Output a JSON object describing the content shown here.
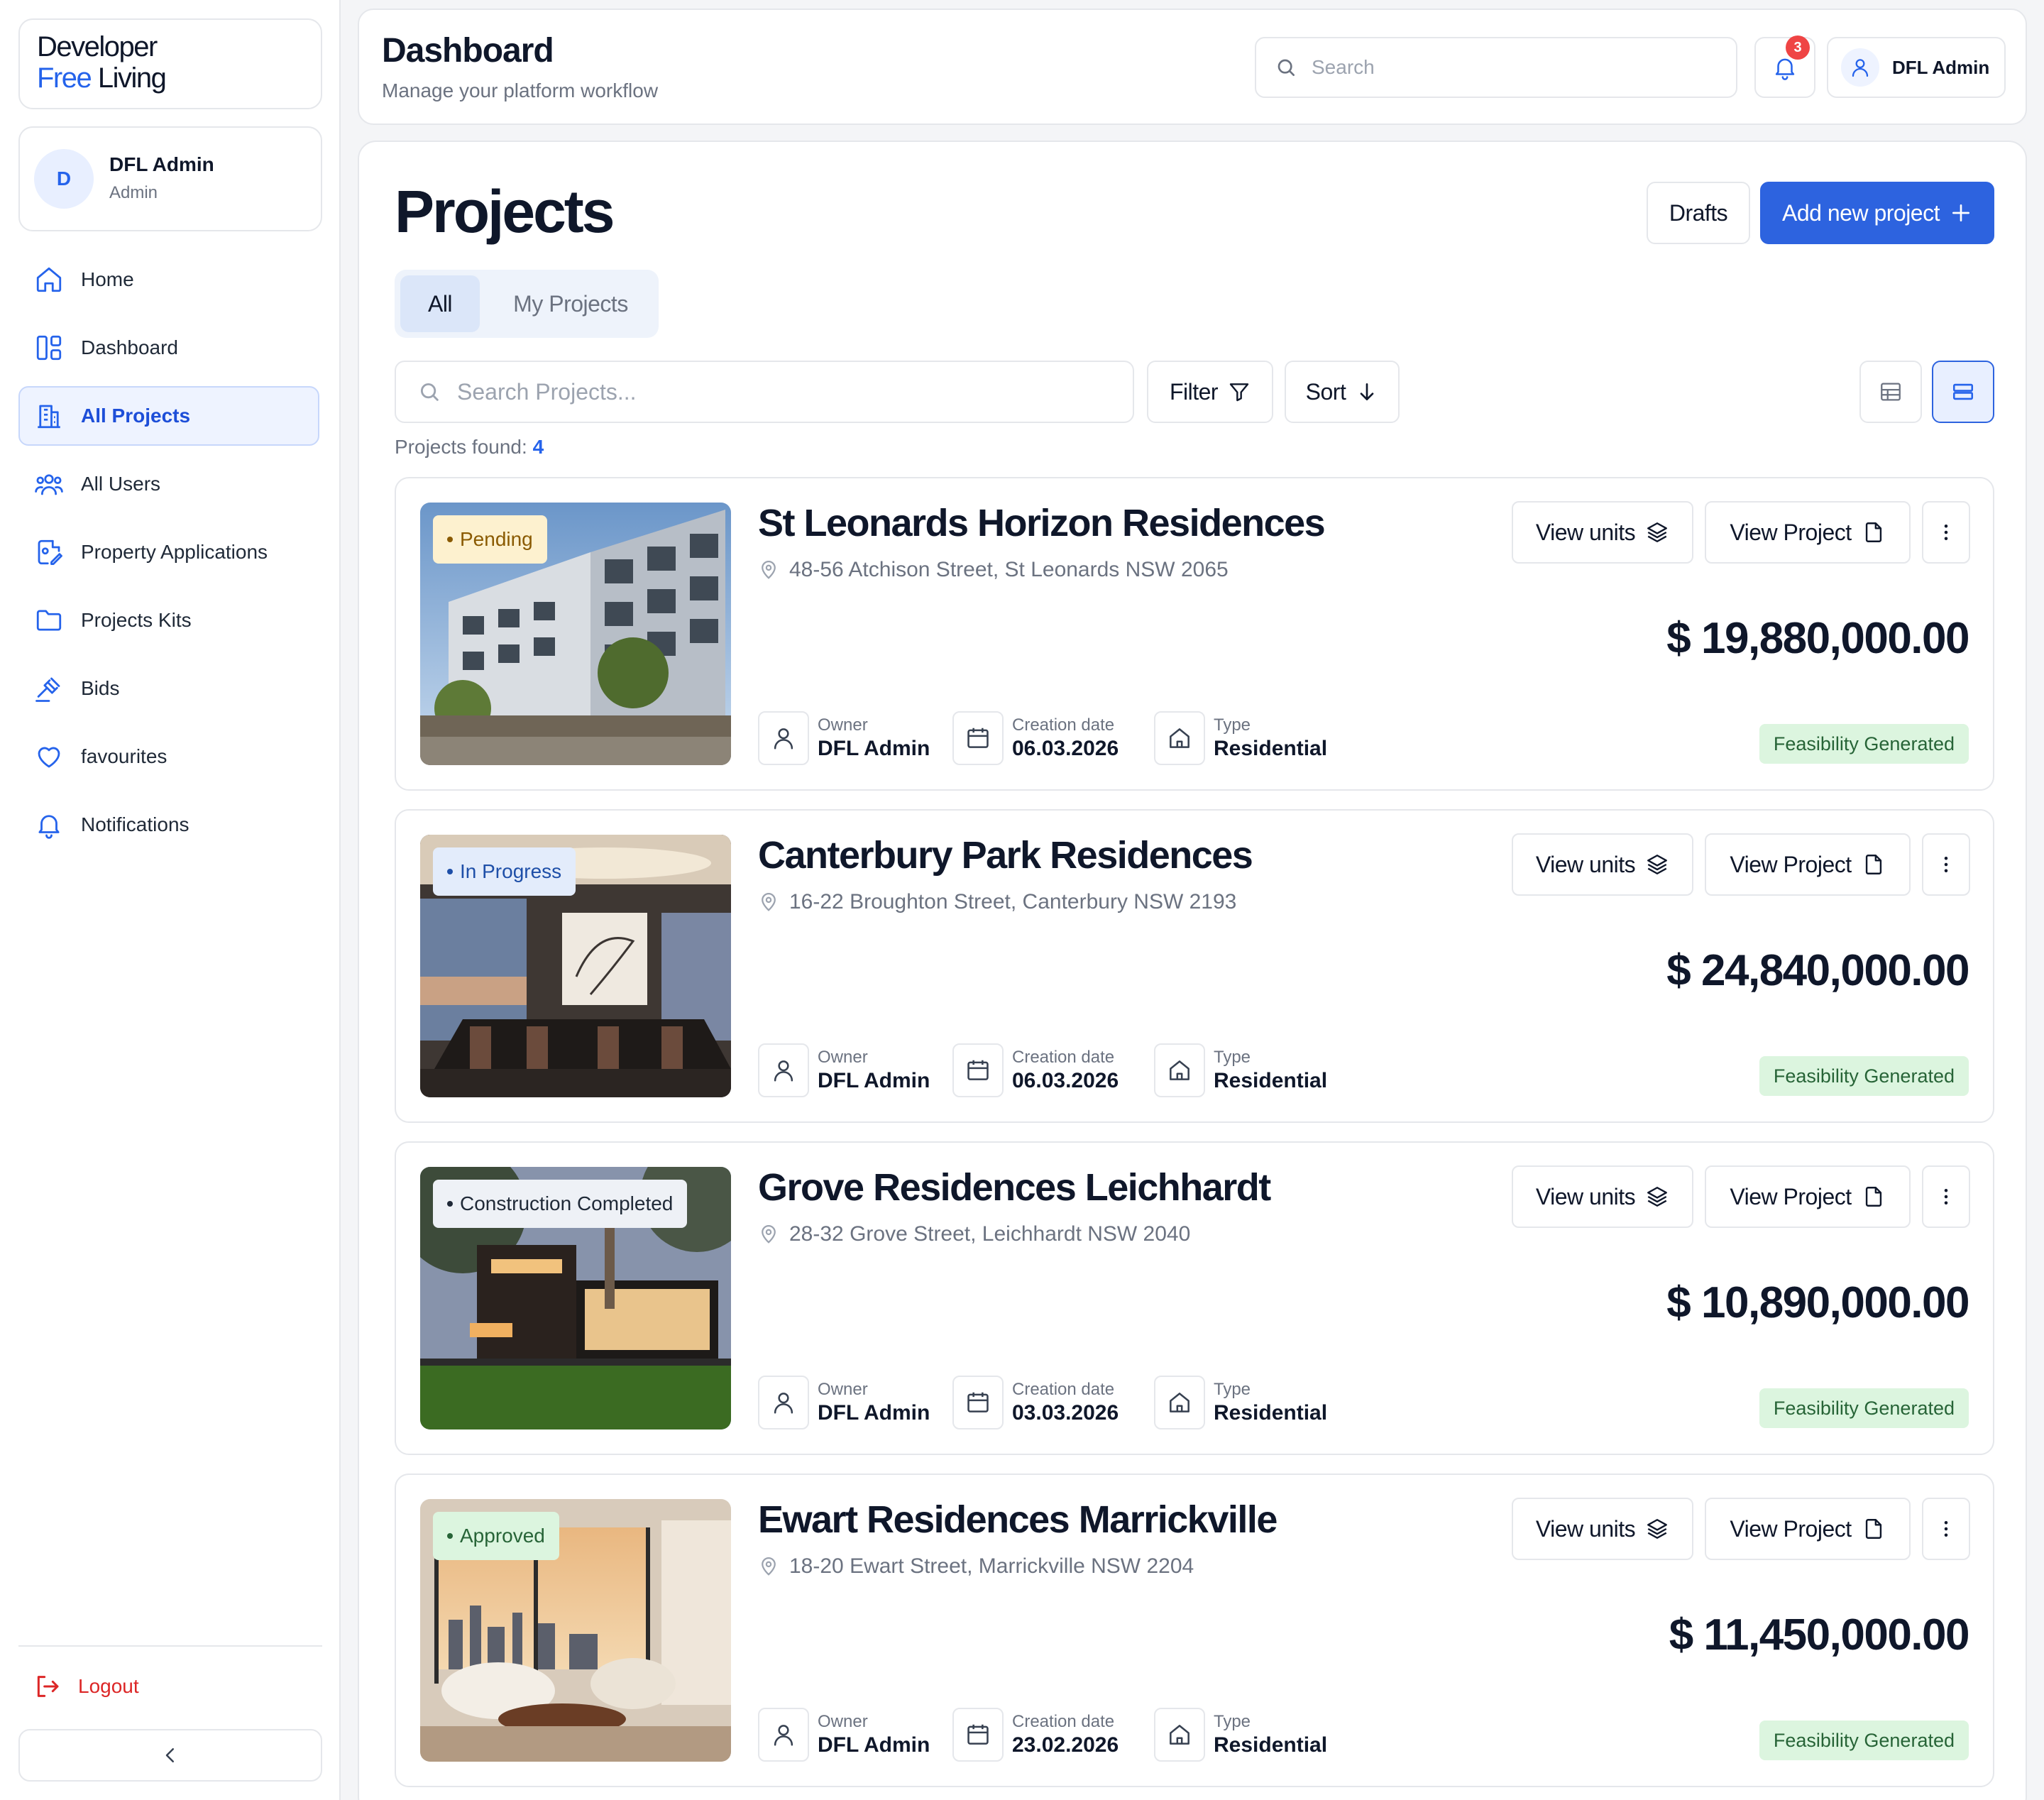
{
  "brand": {
    "line1": "Developer",
    "line2_a": "Free",
    "line2_b": " Living"
  },
  "profile": {
    "initial": "D",
    "name": "DFL Admin",
    "role": "Admin"
  },
  "nav": [
    {
      "label": "Home",
      "icon": "home-icon"
    },
    {
      "label": "Dashboard",
      "icon": "dashboard-icon"
    },
    {
      "label": "All Projects",
      "icon": "building-icon",
      "active": true
    },
    {
      "label": "All Users",
      "icon": "users-icon"
    },
    {
      "label": "Property Applications",
      "icon": "application-icon"
    },
    {
      "label": "Projects Kits",
      "icon": "folder-icon"
    },
    {
      "label": "Bids",
      "icon": "gavel-icon"
    },
    {
      "label": "favourites",
      "icon": "heart-icon"
    },
    {
      "label": "Notifications",
      "icon": "bell-icon"
    }
  ],
  "logout": "Logout",
  "header": {
    "title": "Dashboard",
    "subtitle": "Manage your platform workflow",
    "search_placeholder": "Search",
    "notification_count": "3",
    "user": "DFL Admin"
  },
  "page": {
    "title": "Projects",
    "drafts": "Drafts",
    "add_new": "Add new project",
    "tabs": [
      "All",
      "My Projects"
    ],
    "search_placeholder": "Search Projects...",
    "filter": "Filter",
    "sort": "Sort",
    "found_label": "Projects found:",
    "found_count": "4"
  },
  "labels": {
    "owner": "Owner",
    "creation_date": "Creation date",
    "type": "Type",
    "view_units": "View units",
    "view_project": "View Project"
  },
  "projects": [
    {
      "status": "Pending",
      "title": "St Leonards Horizon Residences",
      "address": "48-56 Atchison Street, St Leonards NSW 2065",
      "price": "$ 19,880,000.00",
      "owner": "DFL Admin",
      "date": "06.03.2026",
      "type": "Residential",
      "feasibility": "Feasibility Generated"
    },
    {
      "status": "In Progress",
      "title": "Canterbury Park Residences",
      "address": "16-22 Broughton Street, Canterbury NSW 2193",
      "price": "$ 24,840,000.00",
      "owner": "DFL Admin",
      "date": "06.03.2026",
      "type": "Residential",
      "feasibility": "Feasibility Generated"
    },
    {
      "status": "Construction Completed",
      "title": "Grove Residences Leichhardt",
      "address": "28-32 Grove Street, Leichhardt NSW 2040",
      "price": "$ 10,890,000.00",
      "owner": "DFL Admin",
      "date": "03.03.2026",
      "type": "Residential",
      "feasibility": "Feasibility Generated"
    },
    {
      "status": "Approved",
      "title": "Ewart Residences Marrickville",
      "address": "18-20 Ewart Street, Marrickville NSW 2204",
      "price": "$ 11,450,000.00",
      "owner": "DFL Admin",
      "date": "23.02.2026",
      "type": "Residential",
      "feasibility": "Feasibility Generated"
    }
  ],
  "colors": {
    "accent": "#2d63df",
    "pending_bg": "#fdf1cf",
    "pending_fg": "#8a5a00",
    "progress_bg": "#e3ecfb",
    "progress_fg": "#1e4fa8",
    "completed_bg": "#eef1f6",
    "completed_fg": "#1f2937",
    "approved_bg": "#dcf5df",
    "approved_fg": "#276437"
  }
}
